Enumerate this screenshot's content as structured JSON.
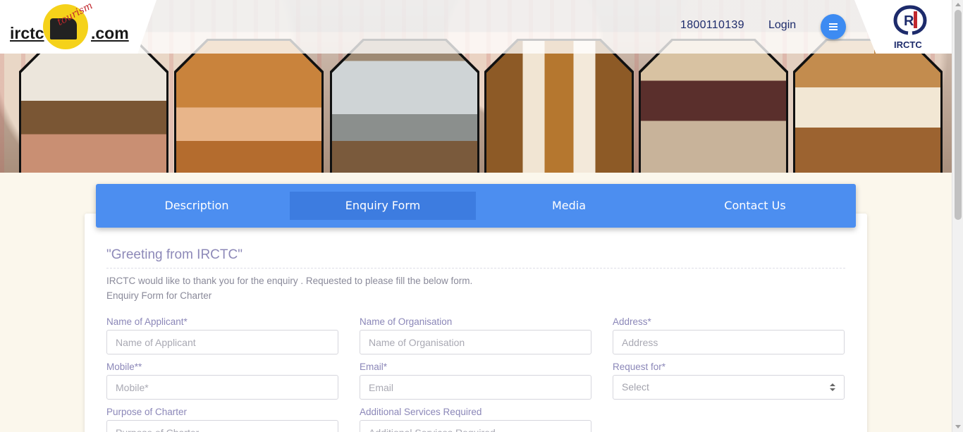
{
  "header": {
    "logo_left": "irctc",
    "logo_right": ".com",
    "logo_badge_text": "tourism",
    "phone": "1800110139",
    "login_label": "Login",
    "brand_label": "IRCTC"
  },
  "colors": {
    "accent": "#4c8ef0",
    "accent_active": "#3d7ce0",
    "menu_button": "#3d8bf2",
    "label_text": "#8b87b8",
    "page_bg": "#fbf7ec"
  },
  "tabs": [
    {
      "label": "Description",
      "active": false
    },
    {
      "label": "Enquiry Form",
      "active": true
    },
    {
      "label": "Media",
      "active": false
    },
    {
      "label": "Contact Us",
      "active": false
    }
  ],
  "content": {
    "greeting": "\"Greeting from IRCTC\"",
    "intro_line1": "IRCTC would like to thank you for the enquiry . Requested to please fill the below form.",
    "intro_line2": "Enquiry Form for Charter"
  },
  "form": {
    "applicant": {
      "label": "Name of Applicant*",
      "placeholder": "Name of Applicant",
      "value": ""
    },
    "organisation": {
      "label": "Name of Organisation",
      "placeholder": "Name of Organisation",
      "value": ""
    },
    "address": {
      "label": "Address*",
      "placeholder": "Address",
      "value": ""
    },
    "mobile": {
      "label": "Mobile**",
      "placeholder": "Mobile*",
      "value": ""
    },
    "email": {
      "label": "Email*",
      "placeholder": "Email",
      "value": ""
    },
    "request_for": {
      "label": "Request for*",
      "selected": "Select"
    },
    "purpose": {
      "label": "Purpose of Charter",
      "placeholder": "Purpose of Charter",
      "value": ""
    },
    "additional": {
      "label": "Additional Services Required",
      "placeholder": "Additional Services Required",
      "value": ""
    }
  },
  "icons": {
    "menu": "hamburger-icon",
    "brand": "irctc-emblem-icon",
    "select": "select-arrows-icon"
  }
}
